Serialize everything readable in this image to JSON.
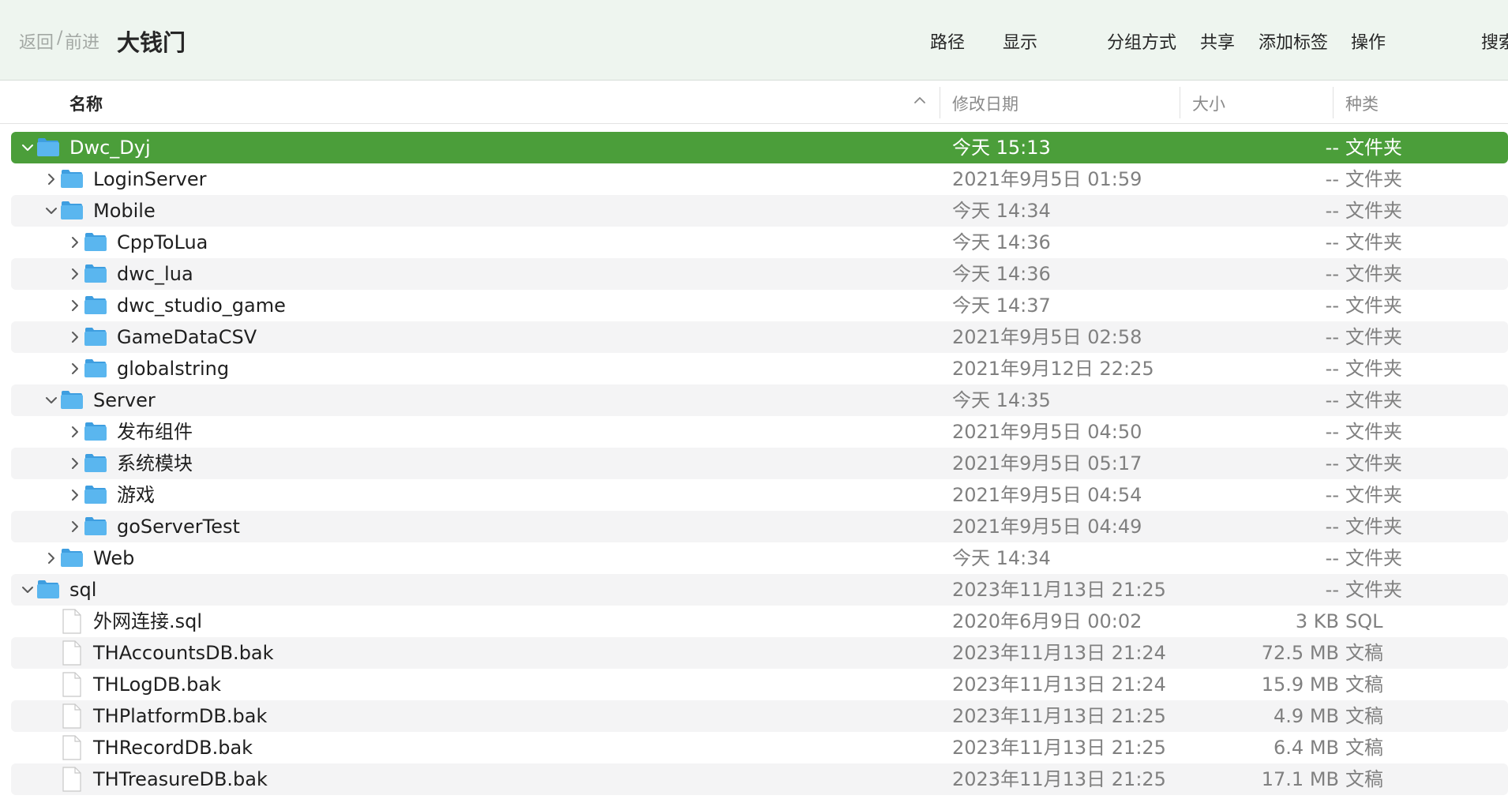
{
  "toolbar": {
    "back_label": "返回",
    "separator": "/",
    "forward_label": "前进",
    "title": "大钱门",
    "path_label": "路径",
    "view_label": "显示",
    "group_label": "分组方式",
    "share_label": "共享",
    "tags_label": "添加标签",
    "action_label": "操作",
    "search_label": "搜索"
  },
  "columns": {
    "name": "名称",
    "date": "修改日期",
    "size": "大小",
    "kind": "种类"
  },
  "colors": {
    "selection": "#4b9e3a",
    "folder": "#5ab6ef",
    "toolbar_bg": "#eef5ef"
  },
  "rows": [
    {
      "name": "Dwc_Dyj",
      "date": "今天 15:13",
      "size": "--",
      "kind": "文件夹",
      "level": 0,
      "type": "folder",
      "expanded": true,
      "selected": true
    },
    {
      "name": "LoginServer",
      "date": "2021年9月5日 01:59",
      "size": "--",
      "kind": "文件夹",
      "level": 1,
      "type": "folder",
      "expanded": false
    },
    {
      "name": "Mobile",
      "date": "今天 14:34",
      "size": "--",
      "kind": "文件夹",
      "level": 1,
      "type": "folder",
      "expanded": true
    },
    {
      "name": "CppToLua",
      "date": "今天 14:36",
      "size": "--",
      "kind": "文件夹",
      "level": 2,
      "type": "folder",
      "expanded": false
    },
    {
      "name": "dwc_lua",
      "date": "今天 14:36",
      "size": "--",
      "kind": "文件夹",
      "level": 2,
      "type": "folder",
      "expanded": false
    },
    {
      "name": "dwc_studio_game",
      "date": "今天 14:37",
      "size": "--",
      "kind": "文件夹",
      "level": 2,
      "type": "folder",
      "expanded": false
    },
    {
      "name": "GameDataCSV",
      "date": "2021年9月5日 02:58",
      "size": "--",
      "kind": "文件夹",
      "level": 2,
      "type": "folder",
      "expanded": false
    },
    {
      "name": "globalstring",
      "date": "2021年9月12日 22:25",
      "size": "--",
      "kind": "文件夹",
      "level": 2,
      "type": "folder",
      "expanded": false
    },
    {
      "name": "Server",
      "date": "今天 14:35",
      "size": "--",
      "kind": "文件夹",
      "level": 1,
      "type": "folder",
      "expanded": true
    },
    {
      "name": "发布组件",
      "date": "2021年9月5日 04:50",
      "size": "--",
      "kind": "文件夹",
      "level": 2,
      "type": "folder",
      "expanded": false
    },
    {
      "name": "系统模块",
      "date": "2021年9月5日 05:17",
      "size": "--",
      "kind": "文件夹",
      "level": 2,
      "type": "folder",
      "expanded": false
    },
    {
      "name": "游戏",
      "date": "2021年9月5日 04:54",
      "size": "--",
      "kind": "文件夹",
      "level": 2,
      "type": "folder",
      "expanded": false
    },
    {
      "name": "goServerTest",
      "date": "2021年9月5日 04:49",
      "size": "--",
      "kind": "文件夹",
      "level": 2,
      "type": "folder",
      "expanded": false
    },
    {
      "name": "Web",
      "date": "今天 14:34",
      "size": "--",
      "kind": "文件夹",
      "level": 1,
      "type": "folder",
      "expanded": false
    },
    {
      "name": "sql",
      "date": "2023年11月13日 21:25",
      "size": "--",
      "kind": "文件夹",
      "level": 0,
      "type": "folder",
      "expanded": true
    },
    {
      "name": "外网连接.sql",
      "date": "2020年6月9日 00:02",
      "size": "3 KB",
      "kind": "SQL",
      "level": 1,
      "type": "file"
    },
    {
      "name": "THAccountsDB.bak",
      "date": "2023年11月13日 21:24",
      "size": "72.5 MB",
      "kind": "文稿",
      "level": 1,
      "type": "file"
    },
    {
      "name": "THLogDB.bak",
      "date": "2023年11月13日 21:24",
      "size": "15.9 MB",
      "kind": "文稿",
      "level": 1,
      "type": "file"
    },
    {
      "name": "THPlatformDB.bak",
      "date": "2023年11月13日 21:25",
      "size": "4.9 MB",
      "kind": "文稿",
      "level": 1,
      "type": "file"
    },
    {
      "name": "THRecordDB.bak",
      "date": "2023年11月13日 21:25",
      "size": "6.4 MB",
      "kind": "文稿",
      "level": 1,
      "type": "file"
    },
    {
      "name": "THTreasureDB.bak",
      "date": "2023年11月13日 21:25",
      "size": "17.1 MB",
      "kind": "文稿",
      "level": 1,
      "type": "file"
    }
  ]
}
